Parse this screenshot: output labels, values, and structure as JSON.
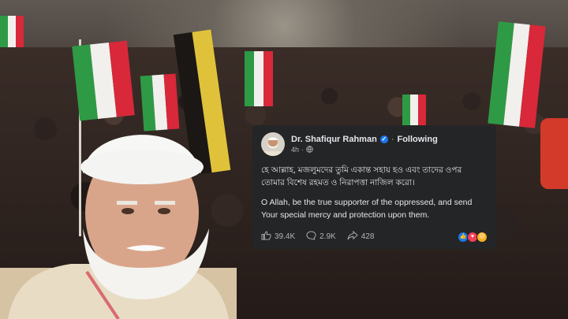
{
  "post": {
    "author": "Dr. Shafiqur Rahman",
    "time": "4h",
    "follow_label": "Following",
    "text_bn": "হে আল্লাহ, মজলুমদের তুমি একান্ত সহায় হও এবং তাদের ওপর তোমার বিশেষ রহমত ও নিরাপত্তা নাজিল করো।",
    "text_en": "O Allah, be the true supporter of the oppressed, and send Your special mercy and protection upon them.",
    "likes": "39.4K",
    "comments": "2.9K",
    "shares": "428",
    "icons": {
      "verified": "verified-badge-icon",
      "globe": "globe-icon",
      "like": "like-icon",
      "comment": "comment-icon",
      "share": "share-icon",
      "reactions": [
        "like-reaction-icon",
        "love-reaction-icon",
        "sad-reaction-icon"
      ]
    },
    "colors": {
      "card_bg": "#242526",
      "verified": "#1877f2"
    }
  }
}
